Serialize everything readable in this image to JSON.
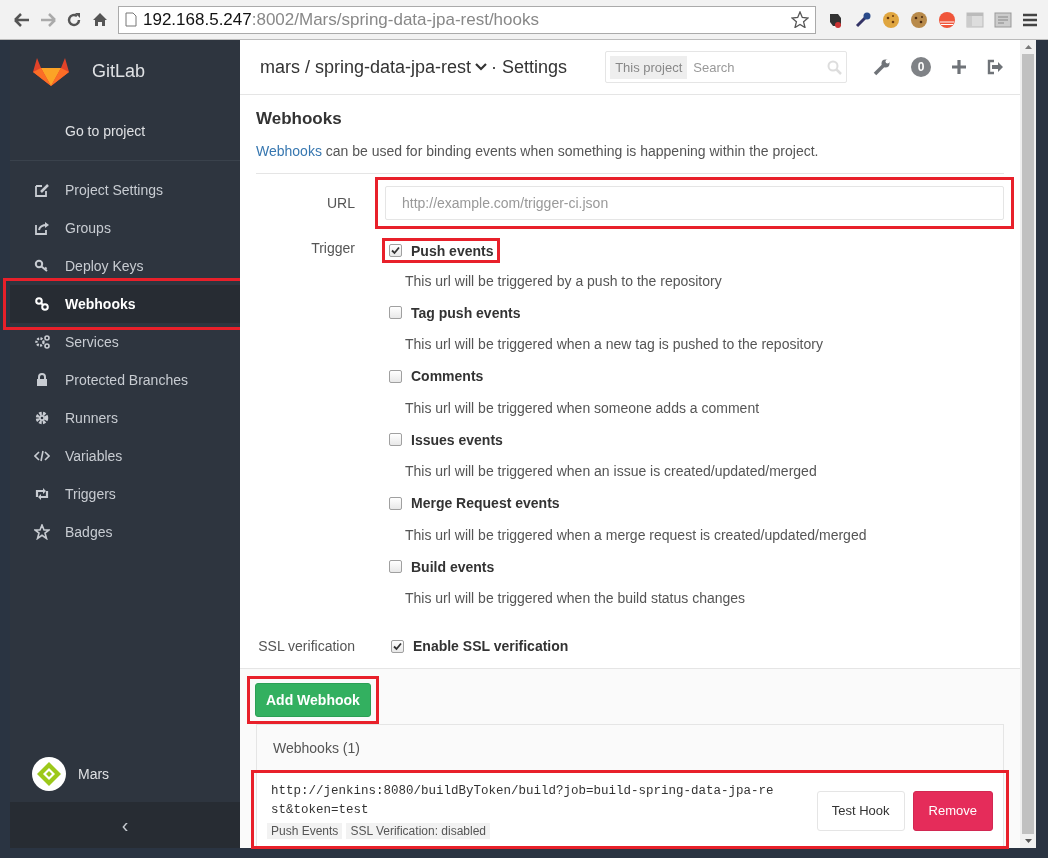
{
  "browser": {
    "url_host": "192.168.5.247",
    "url_rest": ":8002/Mars/spring-data-jpa-rest/hooks"
  },
  "sidebar": {
    "logo_text": "GitLab",
    "go_to_project": "Go to project",
    "items": [
      {
        "label": "Project Settings",
        "selected": false,
        "highlighted": false
      },
      {
        "label": "Groups",
        "selected": false,
        "highlighted": false
      },
      {
        "label": "Deploy Keys",
        "selected": false,
        "highlighted": false
      },
      {
        "label": "Webhooks",
        "selected": true,
        "highlighted": true
      },
      {
        "label": "Services",
        "selected": false,
        "highlighted": false
      },
      {
        "label": "Protected Branches",
        "selected": false,
        "highlighted": false
      },
      {
        "label": "Runners",
        "selected": false,
        "highlighted": false
      },
      {
        "label": "Variables",
        "selected": false,
        "highlighted": false
      },
      {
        "label": "Triggers",
        "selected": false,
        "highlighted": false
      },
      {
        "label": "Badges",
        "selected": false,
        "highlighted": false
      }
    ],
    "user": {
      "name": "Mars"
    },
    "collapse": "‹"
  },
  "header": {
    "breadcrumb": "mars / spring-data-jpa-rest",
    "page": "· Settings",
    "search_scope": "This project",
    "search_placeholder": "Search",
    "notification_count": "0"
  },
  "form": {
    "title": "Webhooks",
    "intro_link": "Webhooks",
    "intro_text": " can be used for binding events when something is happening within the project.",
    "url": {
      "label": "URL",
      "placeholder": "http://example.com/trigger-ci.json",
      "highlighted": true
    },
    "trigger_label": "Trigger",
    "triggers": [
      {
        "label": "Push events",
        "description": "This url will be triggered by a push to the repository",
        "checked": true,
        "highlighted": true
      },
      {
        "label": "Tag push events",
        "description": "This url will be triggered when a new tag is pushed to the repository",
        "checked": false,
        "highlighted": false
      },
      {
        "label": "Comments",
        "description": "This url will be triggered when someone adds a comment",
        "checked": false,
        "highlighted": false
      },
      {
        "label": "Issues events",
        "description": "This url will be triggered when an issue is created/updated/merged",
        "checked": false,
        "highlighted": false
      },
      {
        "label": "Merge Request events",
        "description": "This url will be triggered when a merge request is created/updated/merged",
        "checked": false,
        "highlighted": false
      },
      {
        "label": "Build events",
        "description": "This url will be triggered when the build status changes",
        "checked": false,
        "highlighted": false
      }
    ],
    "ssl": {
      "label": "SSL verification",
      "option": "Enable SSL verification",
      "checked": true
    },
    "submit": {
      "label": "Add Webhook",
      "highlighted": true
    }
  },
  "hooks": {
    "title": "Webhooks (1)",
    "items": [
      {
        "url": "http://jenkins:8080/buildByToken/build?job=build-spring-data-jpa-rest&token=test",
        "tags": [
          "Push Events",
          "SSL Verification: disabled"
        ],
        "test_button": "Test Hook",
        "remove_button": "Remove",
        "highlighted": true
      }
    ]
  }
}
